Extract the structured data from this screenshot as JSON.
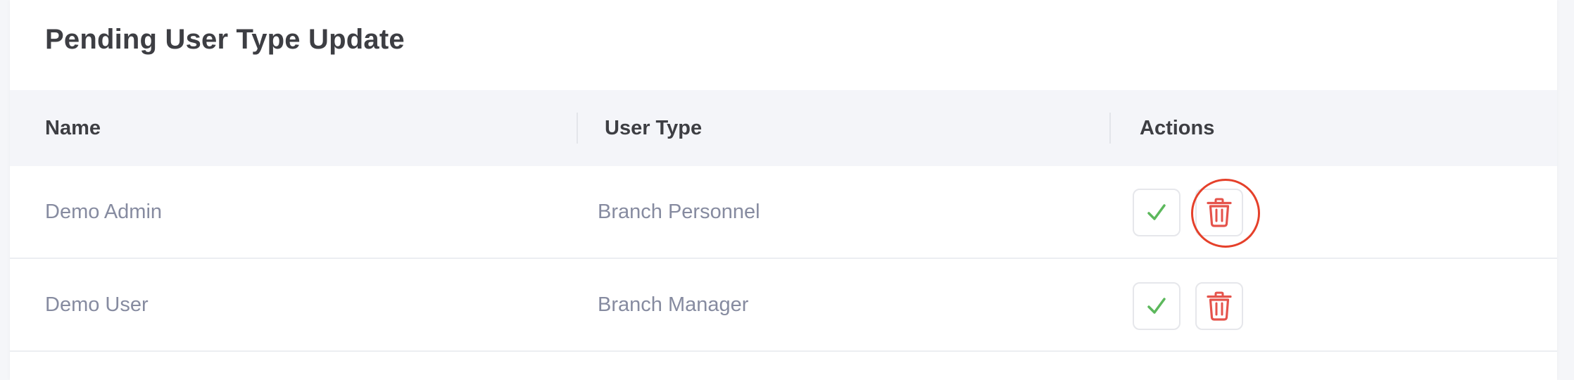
{
  "card": {
    "title": "Pending User Type Update"
  },
  "table": {
    "columns": [
      "Name",
      "User Type",
      "Actions"
    ],
    "rows": [
      {
        "name": "Demo Admin",
        "user_type": "Branch Personnel"
      },
      {
        "name": "Demo User",
        "user_type": "Branch Manager"
      }
    ]
  },
  "colors": {
    "approve": "#5cb85c",
    "delete": "#e5534b",
    "highlight": "#e5402a"
  },
  "icons": {
    "approve": "check-icon",
    "delete": "trash-icon"
  }
}
